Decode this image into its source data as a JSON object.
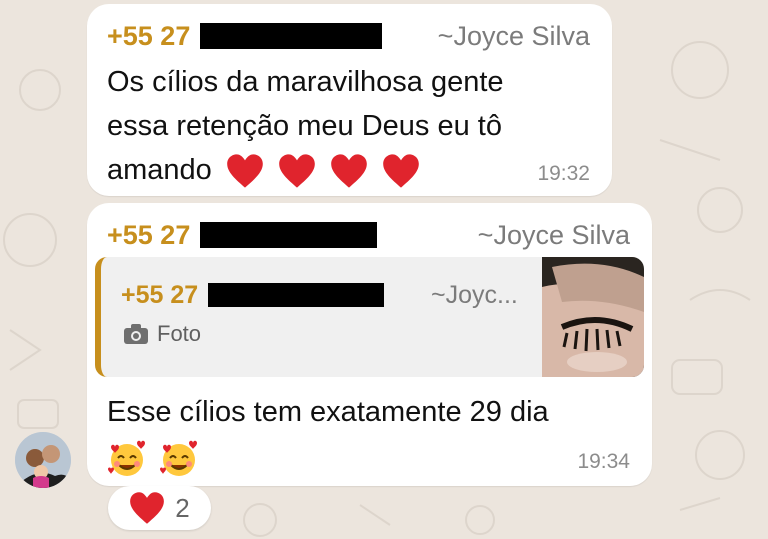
{
  "messages": [
    {
      "sender_phone": "+55 27",
      "sender_alias": "~Joyce Silva",
      "text_lines": [
        "Os cílios da maravilhosa gente",
        "essa retenção meu Deus eu tô",
        "amando"
      ],
      "emojis": [
        "red-heart",
        "red-heart",
        "red-heart",
        "red-heart"
      ],
      "time": "19:32"
    },
    {
      "sender_phone": "+55 27",
      "sender_alias": "~Joyce Silva",
      "quote": {
        "sender_phone": "+55 27",
        "sender_alias": "~Joyc...",
        "media_label": "Foto",
        "media_icon": "camera-icon"
      },
      "text_line": "Esse cílios tem exatamente 29 dia",
      "emojis": [
        "smiling-face-with-hearts",
        "smiling-face-with-hearts"
      ],
      "time": "19:34"
    }
  ],
  "reaction": {
    "emoji": "red-heart",
    "count": "2"
  },
  "colors": {
    "background": "#ece5dd",
    "bubble": "#ffffff",
    "sender": "#c78f1d",
    "alias": "#7b7b7b",
    "time": "#8c8c8c",
    "quote_background": "#f0f0f0"
  }
}
